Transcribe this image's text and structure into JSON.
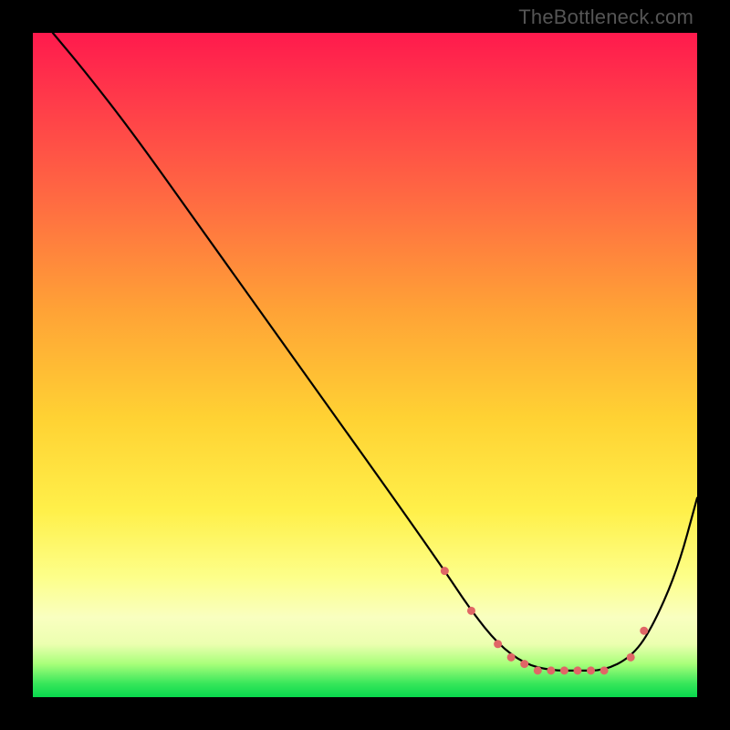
{
  "watermark": {
    "text": "TheBottleneck.com"
  },
  "chart_data": {
    "type": "line",
    "title": "",
    "xlabel": "",
    "ylabel": "",
    "xlim": [
      0,
      100
    ],
    "ylim": [
      0,
      100
    ],
    "grid": false,
    "legend": false,
    "gradient_stops": [
      {
        "pos": 0,
        "color": "#ff1a4d"
      },
      {
        "pos": 10,
        "color": "#ff3a4a"
      },
      {
        "pos": 25,
        "color": "#ff6a42"
      },
      {
        "pos": 42,
        "color": "#ffa336"
      },
      {
        "pos": 58,
        "color": "#ffd233"
      },
      {
        "pos": 72,
        "color": "#fff04a"
      },
      {
        "pos": 82,
        "color": "#fdff8a"
      },
      {
        "pos": 88,
        "color": "#f9ffc0"
      },
      {
        "pos": 92,
        "color": "#ecffb0"
      },
      {
        "pos": 95,
        "color": "#a8ff7a"
      },
      {
        "pos": 98,
        "color": "#36e65a"
      },
      {
        "pos": 100,
        "color": "#08d84d"
      }
    ],
    "series": [
      {
        "name": "curve",
        "color": "#000000",
        "x": [
          3,
          8,
          15,
          25,
          35,
          45,
          55,
          62,
          66,
          70,
          74,
          78,
          82,
          86,
          90,
          93,
          97,
          100
        ],
        "y": [
          100,
          94,
          85,
          71,
          57,
          43,
          29,
          19,
          13,
          8,
          5,
          4,
          4,
          4,
          6,
          10,
          19,
          30
        ]
      }
    ],
    "markers": [
      {
        "name": "flat-region-dots",
        "color": "#e06666",
        "x": [
          62,
          66,
          70,
          72,
          74,
          76,
          78,
          80,
          82,
          84,
          86,
          90,
          92
        ],
        "y": [
          19,
          13,
          8,
          6,
          5,
          4,
          4,
          4,
          4,
          4,
          4,
          6,
          10
        ]
      }
    ]
  }
}
